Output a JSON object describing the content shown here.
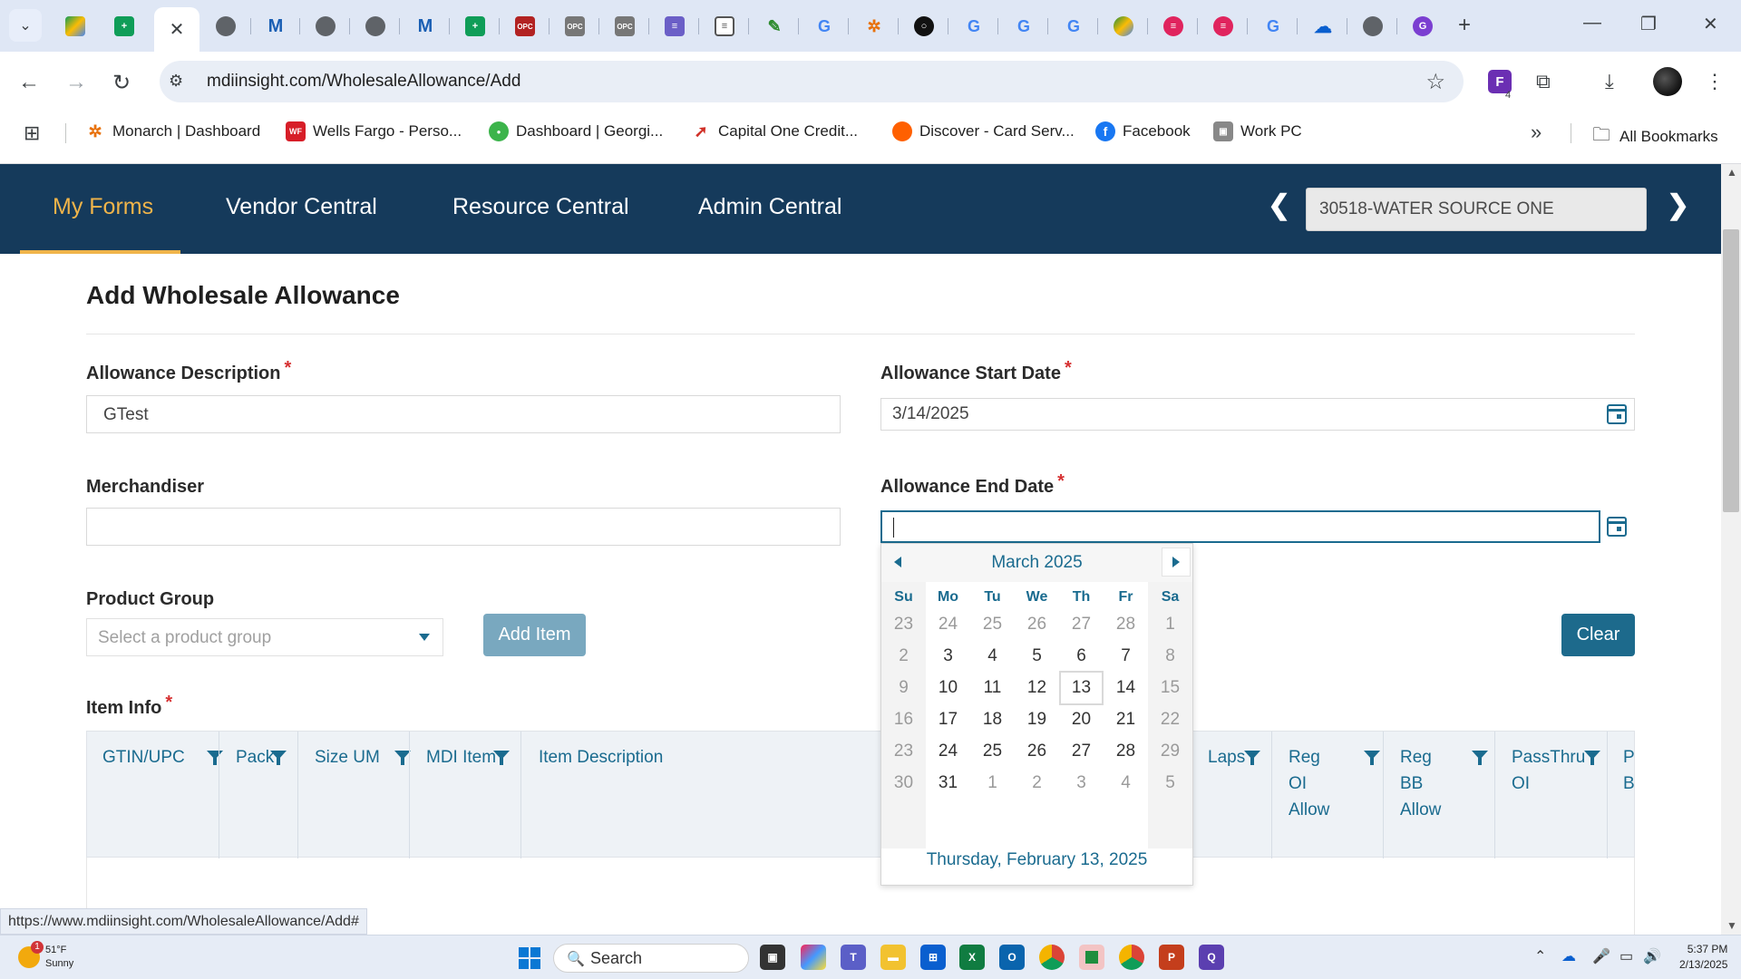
{
  "browser": {
    "url": "mdiinsight.com/WholesaleAllowance/Add",
    "status_url": "https://www.mdiinsight.com/WholesaleAllowance/Add#",
    "bookmarks": [
      "Monarch | Dashboard",
      "Wells Fargo - Perso...",
      "Dashboard | Georgi...",
      "Capital One Credit...",
      "Discover - Card Serv...",
      "Facebook",
      "Work PC"
    ],
    "all_bookmarks": "All Bookmarks",
    "extension_badge_count": "4"
  },
  "appnav": {
    "items": [
      "My Forms",
      "Vendor Central",
      "Resource Central",
      "Admin Central"
    ],
    "active": "My Forms",
    "vendor": "30518-WATER SOURCE ONE"
  },
  "form": {
    "title": "Add Wholesale Allowance",
    "required_mark": "*",
    "description_label": "Allowance Description",
    "description_value": "GTest",
    "start_label": "Allowance Start Date",
    "start_value": "3/14/2025",
    "merchandiser_label": "Merchandiser",
    "merchandiser_value": "",
    "end_label": "Allowance End Date",
    "end_value": "",
    "product_group_label": "Product Group",
    "product_group_placeholder": "Select a product group",
    "add_item": "Add Item",
    "clear": "Clear",
    "item_info_label": "Item Info"
  },
  "table": {
    "columns": [
      "GTIN/UPC",
      "Pack",
      "Size UM",
      "MDI Item",
      "Item Description",
      "Laps",
      "Reg OI Allow",
      "Reg BB Allow",
      "PassThru OI",
      "P B"
    ]
  },
  "datepicker": {
    "month": "March 2025",
    "days_of_week": [
      "Su",
      "Mo",
      "Tu",
      "We",
      "Th",
      "Fr",
      "Sa"
    ],
    "weeks": [
      [
        "23",
        "24",
        "25",
        "26",
        "27",
        "28",
        "1"
      ],
      [
        "2",
        "3",
        "4",
        "5",
        "6",
        "7",
        "8"
      ],
      [
        "9",
        "10",
        "11",
        "12",
        "13",
        "14",
        "15"
      ],
      [
        "16",
        "17",
        "18",
        "19",
        "20",
        "21",
        "22"
      ],
      [
        "23",
        "24",
        "25",
        "26",
        "27",
        "28",
        "29"
      ],
      [
        "30",
        "31",
        "1",
        "2",
        "3",
        "4",
        "5"
      ]
    ],
    "today_footer": "Thursday, February 13, 2025"
  },
  "taskbar": {
    "temperature": "51°F",
    "condition": "Sunny",
    "weather_badge": "1",
    "search": "Search",
    "time": "5:37 PM",
    "date": "2/13/2025"
  },
  "colors": {
    "nav_bg": "#153a5b",
    "accent_gold": "#f0b44a",
    "teal": "#1a6b8f",
    "add_item_btn": "#79a8bf",
    "clear_btn": "#1d6a8c"
  }
}
